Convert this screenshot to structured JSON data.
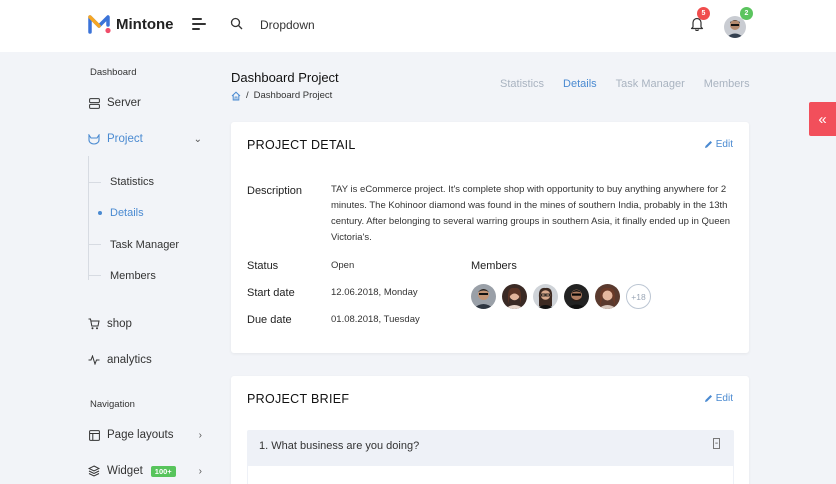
{
  "header": {
    "brand": "Mintone",
    "search_value": "Dropdown",
    "notifications_count": "5",
    "user_badge": "2"
  },
  "sidebar": {
    "section_dashboard": "Dashboard",
    "server": "Server",
    "project": "Project",
    "project_sub": [
      "Statistics",
      "Details",
      "Task Manager",
      "Members"
    ],
    "shop": "shop",
    "analytics": "analytics",
    "section_navigation": "Navigation",
    "page_layouts": "Page layouts",
    "widget": "Widget",
    "widget_badge": "100+"
  },
  "page": {
    "title": "Dashboard Project",
    "breadcrumb_sep": "/",
    "breadcrumb_current": "Dashboard Project",
    "tabs": [
      "Statistics",
      "Details",
      "Task Manager",
      "Members"
    ],
    "active_tab": "Details"
  },
  "project_detail": {
    "title": "PROJECT DETAIL",
    "edit": "Edit",
    "description_label": "Description",
    "description": "TAY is eCommerce project. It's complete shop with opportunity to buy anything anywhere for 2 minutes. The Kohinoor diamond was found in the mines of southern India, probably in the 13th century. After belonging to several warring groups in southern Asia, it finally ended up in Queen Victoria's.",
    "status_label": "Status",
    "status": "Open",
    "start_label": "Start date",
    "start": "12.06.2018, Monday",
    "due_label": "Due date",
    "due": "01.08.2018, Tuesday",
    "members_label": "Members",
    "members_more": "+18"
  },
  "project_brief": {
    "title": "PROJECT BRIEF",
    "edit": "Edit",
    "question": "1. What business are you doing?"
  },
  "colors": {
    "accent": "#4a8ad1",
    "danger": "#f24f5b",
    "success": "#58c45c"
  }
}
